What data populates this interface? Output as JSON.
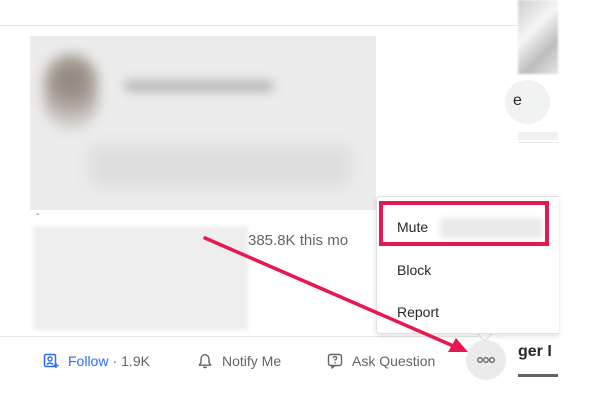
{
  "right_column": {
    "pill_letter": "e",
    "tab_truncated": "ger I"
  },
  "answer": {
    "views_text": "385.8K this mo",
    "tiny_mark": "-"
  },
  "actions": {
    "follow_label": "Follow",
    "follow_separator": "·",
    "follow_count": "1.9K",
    "notify_label": "Notify Me",
    "ask_label": "Ask Question"
  },
  "menu": {
    "items": [
      {
        "label": "Mute"
      },
      {
        "label": "Block"
      },
      {
        "label": "Report"
      }
    ]
  },
  "icons": {
    "follow": "follow-person-icon",
    "notify": "bell-icon",
    "ask": "question-icon",
    "more": "more-dots-icon"
  },
  "colors": {
    "accent_blue": "#2e69ff",
    "annotation_red": "#e8174f",
    "text_gray": "#636466",
    "text_dark": "#282829"
  }
}
